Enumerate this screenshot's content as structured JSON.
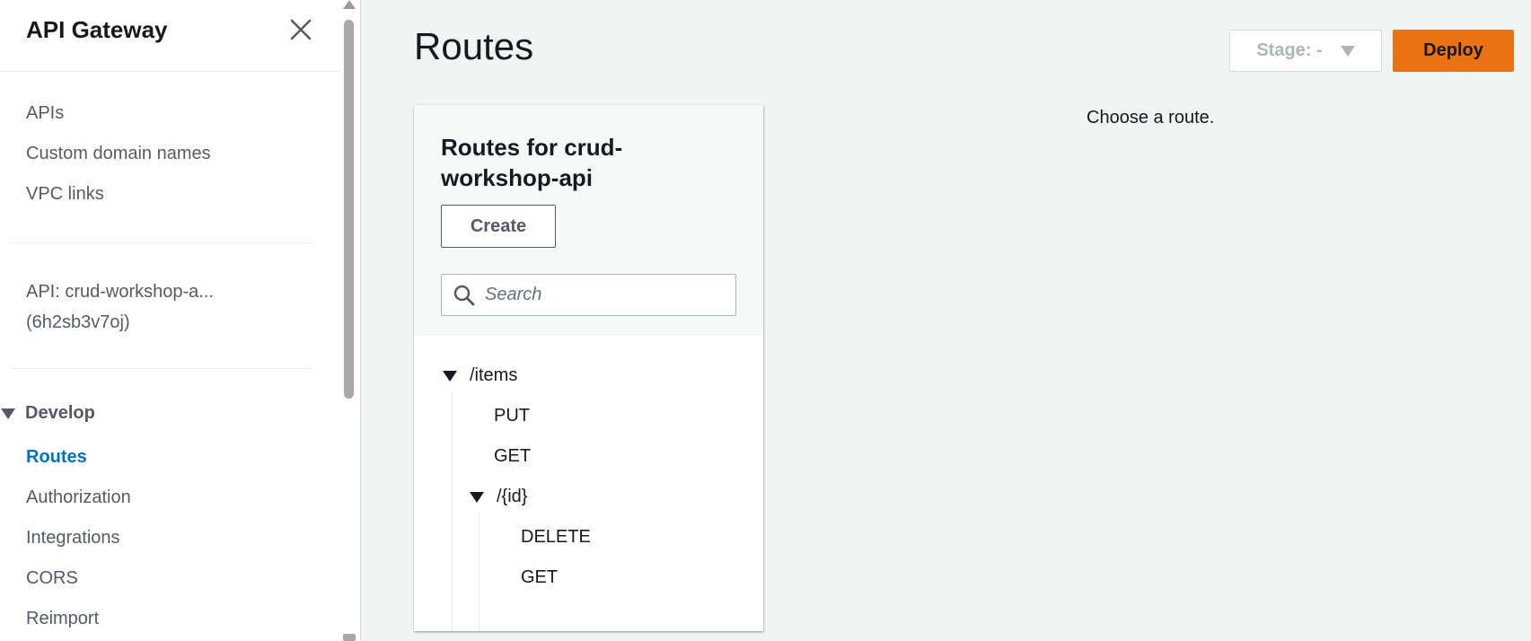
{
  "sidebar": {
    "title": "API Gateway",
    "nav": [
      {
        "label": "APIs"
      },
      {
        "label": "Custom domain names"
      },
      {
        "label": "VPC links"
      }
    ],
    "api": {
      "name": "API: crud-workshop-a...",
      "id": "(6h2sb3v7oj)"
    },
    "section": {
      "label": "Develop",
      "items": [
        {
          "label": "Routes",
          "active": true
        },
        {
          "label": "Authorization"
        },
        {
          "label": "Integrations"
        },
        {
          "label": "CORS"
        },
        {
          "label": "Reimport"
        }
      ]
    }
  },
  "header": {
    "title": "Routes",
    "stage_label": "Stage: -",
    "deploy_label": "Deploy"
  },
  "routes_panel": {
    "title": "Routes for crud-workshop-api",
    "create_label": "Create",
    "search_placeholder": "Search",
    "tree": {
      "resource": "/items",
      "methods": [
        "PUT",
        "GET"
      ],
      "child": {
        "resource": "/{id}",
        "methods": [
          "DELETE",
          "GET"
        ]
      }
    }
  },
  "detail": {
    "message": "Choose a route."
  },
  "colors": {
    "accent": "#0073bb",
    "deploy": "#ec7211",
    "background": "#f2f3f3"
  }
}
